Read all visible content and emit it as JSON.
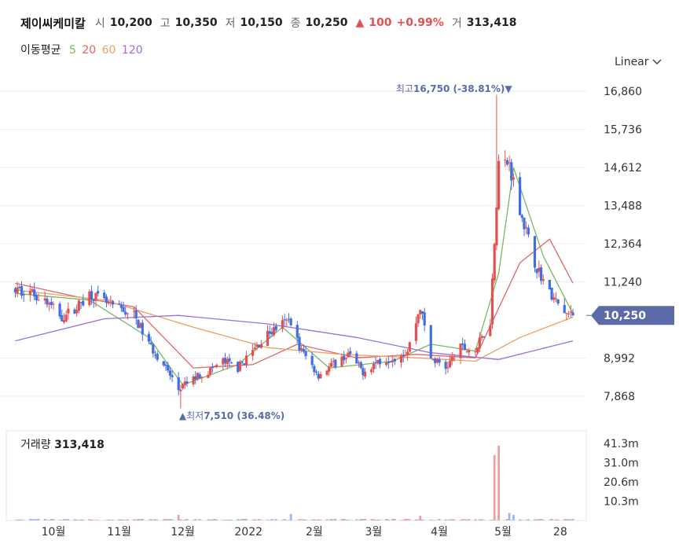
{
  "header": {
    "name": "제이씨케미칼",
    "open_label": "시",
    "open": "10,200",
    "high_label": "고",
    "high": "10,350",
    "low_label": "저",
    "low": "10,150",
    "close_label": "종",
    "close": "10,250",
    "change_arrow": "▲",
    "change": "100",
    "change_pct": "+0.99%",
    "volume_label": "거",
    "volume": "313,418"
  },
  "ma_legend": {
    "label": "이동평균",
    "periods": [
      {
        "value": "5",
        "color": "#7cb85e"
      },
      {
        "value": "20",
        "color": "#e06666"
      },
      {
        "value": "60",
        "color": "#e8a064"
      },
      {
        "value": "120",
        "color": "#9b6fe0"
      }
    ]
  },
  "scale_selector": {
    "value": "Linear",
    "icon": "chevron-down-icon"
  },
  "colors": {
    "up": "#e25151",
    "down": "#3f6fe0",
    "accent": "#5b6aa8",
    "grid": "#eeeeee"
  },
  "chart_data": {
    "type": "candlestick",
    "x_labels": [
      "10월",
      "11월",
      "12월",
      "2022",
      "2월",
      "3월",
      "4월",
      "5월",
      "28"
    ],
    "y_ticks": [
      "16,860",
      "15,736",
      "14,612",
      "13,488",
      "12,364",
      "11,240",
      "8,992",
      "7,868"
    ],
    "ylim": [
      7500,
      17200
    ],
    "current_price": {
      "label": "10,250",
      "value": 10250
    },
    "annotations": [
      {
        "label": "최고",
        "value": "16,750",
        "pct": "(-38.81%)",
        "marker": "▼",
        "price": 16750,
        "date": "2022-04-28"
      },
      {
        "label": "최저",
        "value": "7,510",
        "pct": "(36.48%)",
        "marker": "▲",
        "price": 7510,
        "date": "2021-11-30"
      }
    ],
    "price_points": [
      [
        "2021-09-13",
        11000
      ],
      [
        "2021-09-20",
        10950
      ],
      [
        "2021-09-27",
        10700
      ],
      [
        "2021-10-05",
        10200
      ],
      [
        "2021-10-12",
        10500
      ],
      [
        "2021-10-18",
        10900
      ],
      [
        "2021-10-26",
        10600
      ],
      [
        "2021-11-01",
        10450
      ],
      [
        "2021-11-08",
        10250
      ],
      [
        "2021-11-15",
        9400
      ],
      [
        "2021-11-22",
        8800
      ],
      [
        "2021-11-29",
        8050
      ],
      [
        "2021-12-06",
        8400
      ],
      [
        "2021-12-13",
        8600
      ],
      [
        "2021-12-20",
        8900
      ],
      [
        "2021-12-27",
        8700
      ],
      [
        "2022-01-03",
        9200
      ],
      [
        "2022-01-10",
        9700
      ],
      [
        "2022-01-17",
        10000
      ],
      [
        "2022-01-21",
        10100
      ],
      [
        "2022-01-25",
        9300
      ],
      [
        "2022-02-03",
        8500
      ],
      [
        "2022-02-10",
        8800
      ],
      [
        "2022-02-17",
        9100
      ],
      [
        "2022-02-24",
        8600
      ],
      [
        "2022-03-03",
        8900
      ],
      [
        "2022-03-10",
        9000
      ],
      [
        "2022-03-17",
        9200
      ],
      [
        "2022-03-23",
        10500
      ],
      [
        "2022-03-28",
        9000
      ],
      [
        "2022-04-04",
        8700
      ],
      [
        "2022-04-11",
        9300
      ],
      [
        "2022-04-18",
        9200
      ],
      [
        "2022-04-25",
        10100
      ],
      [
        "2022-04-29",
        14800
      ],
      [
        "2022-05-04",
        14700
      ],
      [
        "2022-05-09",
        13400
      ],
      [
        "2022-05-16",
        11800
      ],
      [
        "2022-05-23",
        10900
      ],
      [
        "2022-05-30",
        10300
      ],
      [
        "2022-06-03",
        10250
      ]
    ],
    "ma": [
      {
        "period": "5",
        "color": "#7cb85e",
        "points": [
          [
            "2021-09-13",
            10900
          ],
          [
            "2021-10-18",
            10700
          ],
          [
            "2021-11-15",
            9600
          ],
          [
            "2021-12-01",
            8200
          ],
          [
            "2021-12-27",
            8800
          ],
          [
            "2022-01-17",
            9900
          ],
          [
            "2022-02-08",
            8700
          ],
          [
            "2022-03-10",
            8900
          ],
          [
            "2022-03-28",
            9400
          ],
          [
            "2022-04-18",
            9200
          ],
          [
            "2022-04-29",
            11500
          ],
          [
            "2022-05-06",
            14600
          ],
          [
            "2022-05-20",
            12000
          ],
          [
            "2022-06-03",
            10300
          ]
        ]
      },
      {
        "period": "20",
        "color": "#e06666",
        "points": [
          [
            "2021-09-13",
            11200
          ],
          [
            "2021-10-12",
            10800
          ],
          [
            "2021-11-08",
            10500
          ],
          [
            "2021-12-06",
            8700
          ],
          [
            "2022-01-03",
            8800
          ],
          [
            "2022-01-24",
            9400
          ],
          [
            "2022-02-21",
            9000
          ],
          [
            "2022-03-21",
            9100
          ],
          [
            "2022-04-18",
            9000
          ],
          [
            "2022-05-09",
            11800
          ],
          [
            "2022-05-23",
            12500
          ],
          [
            "2022-06-03",
            11200
          ]
        ]
      },
      {
        "period": "60",
        "color": "#e8a064",
        "points": [
          [
            "2021-09-13",
            11000
          ],
          [
            "2021-10-25",
            10700
          ],
          [
            "2021-12-06",
            9900
          ],
          [
            "2022-01-10",
            9300
          ],
          [
            "2022-02-14",
            9100
          ],
          [
            "2022-03-21",
            9000
          ],
          [
            "2022-04-18",
            8900
          ],
          [
            "2022-05-09",
            9600
          ],
          [
            "2022-06-03",
            10200
          ]
        ]
      },
      {
        "period": "120",
        "color": "#9b6fe0",
        "points": [
          [
            "2021-09-13",
            9500
          ],
          [
            "2021-10-25",
            10150
          ],
          [
            "2021-11-29",
            10250
          ],
          [
            "2022-01-10",
            10000
          ],
          [
            "2022-02-21",
            9600
          ],
          [
            "2022-03-28",
            9150
          ],
          [
            "2022-04-29",
            8950
          ],
          [
            "2022-06-03",
            9500
          ]
        ]
      }
    ],
    "volume": {
      "label": "거래량",
      "value": "313,418",
      "y_ticks": [
        "41.3m",
        "31.0m",
        "20.6m",
        "10.3m"
      ],
      "ylim": [
        0,
        48000000
      ],
      "spikes": [
        {
          "date": "2021-11-29",
          "value": 3000000,
          "dir": "up"
        },
        {
          "date": "2022-01-21",
          "value": 3500000,
          "dir": "down"
        },
        {
          "date": "2022-03-23",
          "value": 2500000,
          "dir": "up"
        },
        {
          "date": "2022-04-27",
          "value": 35000000,
          "dir": "up"
        },
        {
          "date": "2022-04-29",
          "value": 40000000,
          "dir": "up"
        },
        {
          "date": "2022-05-04",
          "value": 4000000,
          "dir": "down"
        },
        {
          "date": "2022-05-06",
          "value": 3000000,
          "dir": "down"
        }
      ]
    }
  }
}
